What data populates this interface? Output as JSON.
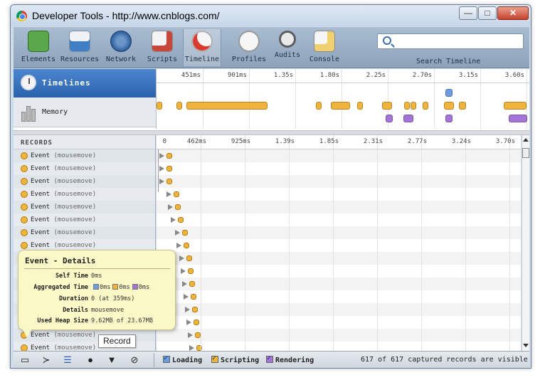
{
  "window": {
    "title": "Developer Tools - http://www.cnblogs.com/",
    "min_glyph": "—",
    "max_glyph": "□",
    "close_glyph": "✕"
  },
  "toolbar": {
    "tools": [
      {
        "name": "elements",
        "label": "Elements",
        "icon": "elements-icon",
        "color": "#5aa64a"
      },
      {
        "name": "resources",
        "label": "Resources",
        "icon": "resources-icon",
        "color": "#3f7fc4"
      },
      {
        "name": "network",
        "label": "Network",
        "icon": "network-icon",
        "color": "#2c5e9e"
      },
      {
        "name": "scripts",
        "label": "Scripts",
        "icon": "scripts-icon",
        "color": "#d6d6d6"
      },
      {
        "name": "timeline",
        "label": "Timeline",
        "icon": "timeline-icon",
        "color": "#e9e9e9",
        "active": true
      },
      {
        "name": "profiles",
        "label": "Profiles",
        "icon": "profiles-icon",
        "color": "#efefef"
      },
      {
        "name": "audits",
        "label": "Audits",
        "icon": "audits-icon",
        "color": "#e4e4e4"
      },
      {
        "name": "console",
        "label": "Console",
        "icon": "console-icon",
        "color": "#f0d070"
      }
    ],
    "search_placeholder": "",
    "search_label": "Search Timeline"
  },
  "overview": {
    "timelines_label": "Timelines",
    "memory_label": "Memory",
    "ticks": [
      "451ms",
      "901ms",
      "1.35s",
      "1.80s",
      "2.25s",
      "2.70s",
      "3.15s",
      "3.60s"
    ]
  },
  "records": {
    "title": "RECORDS",
    "ticks": [
      "0",
      "462ms",
      "925ms",
      "1.39s",
      "1.85s",
      "2.31s",
      "2.77s",
      "3.24s",
      "3.70s"
    ],
    "rows": [
      {
        "type": "Event",
        "detail": "(mousemove)"
      },
      {
        "type": "Event",
        "detail": "(mousemove)"
      },
      {
        "type": "Event",
        "detail": "(mousemove)"
      },
      {
        "type": "Event",
        "detail": "(mousemove)"
      },
      {
        "type": "Event",
        "detail": "(mousemove)"
      },
      {
        "type": "Event",
        "detail": "(mousemove)"
      },
      {
        "type": "Event",
        "detail": "(mousemove)"
      },
      {
        "type": "Event",
        "detail": "(mousemove)"
      },
      {
        "type": "Event",
        "detail": "(mousemove)"
      },
      {
        "type": "Event",
        "detail": "(mousemove)"
      },
      {
        "type": "Event",
        "detail": "(mousemove)"
      },
      {
        "type": "Event",
        "detail": "(mousemove)"
      },
      {
        "type": "Event",
        "detail": "(mousemove)"
      },
      {
        "type": "Event",
        "detail": "(mousemove)"
      },
      {
        "type": "Event",
        "detail": "(mousemove)"
      },
      {
        "type": "Event",
        "detail": "(mousemove)"
      }
    ]
  },
  "details": {
    "title": "Event - Details",
    "self_time_key": "Self Time",
    "self_time": "0ms",
    "aggregated_key": "Aggregated Time",
    "aggregated_loading": "0ms",
    "aggregated_scripting": "0ms",
    "aggregated_rendering": "0ms",
    "duration_key": "Duration",
    "duration": "0 (at 359ms)",
    "details_key": "Details",
    "details_value": "mousemove",
    "heap_key": "Used Heap Size",
    "heap_value": "9.62MB of 23.67MB"
  },
  "statusbar": {
    "dock_glyph": "▭",
    "console_glyph": "≻",
    "list_glyph": "☰",
    "record_glyph": "●",
    "clear_glyph": "▼",
    "gc_glyph": "⊘",
    "filters": [
      {
        "label": "Loading",
        "color": "#6d9de0"
      },
      {
        "label": "Scripting",
        "color": "#f0b43a"
      },
      {
        "label": "Rendering",
        "color": "#a474d8"
      }
    ],
    "status_text": "617 of 617 captured records are visible",
    "record_tooltip": "Record"
  },
  "colors": {
    "loading": "#6d9de0",
    "scripting": "#f0b43a",
    "rendering": "#a474d8",
    "selected": "#3a74c0"
  }
}
